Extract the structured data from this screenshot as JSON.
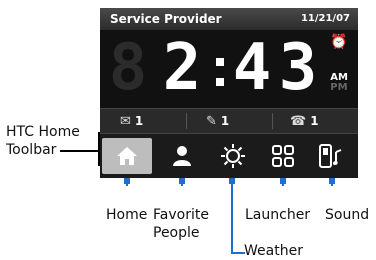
{
  "header": {
    "provider": "Service Provider",
    "date": "11/21/07"
  },
  "clock": {
    "digits": [
      "2",
      ":",
      "4",
      "3"
    ],
    "ampm": [
      "AM",
      "PM"
    ],
    "alarm_icon": "alarm-clock-icon"
  },
  "status": [
    {
      "icon": "email-icon",
      "value": "1"
    },
    {
      "icon": "message-icon",
      "value": "1"
    },
    {
      "icon": "missed-call-icon",
      "value": "1"
    }
  ],
  "toolbar": {
    "tabs": [
      {
        "name": "Home",
        "icon": "home-icon"
      },
      {
        "name": "Favorite People",
        "icon": "person-icon"
      },
      {
        "name": "Weather",
        "icon": "sun-icon"
      },
      {
        "name": "Launcher",
        "icon": "launcher-icon"
      },
      {
        "name": "Sound",
        "icon": "phone-sound-icon"
      }
    ]
  },
  "callouts": {
    "toolbar_line1": "HTC Home",
    "toolbar_line2": "Toolbar",
    "home": "Home",
    "favorite_line1": "Favorite",
    "favorite_line2": "People",
    "weather": "Weather",
    "launcher": "Launcher",
    "sound": "Sound"
  },
  "colors": {
    "accent_blue": "#1f6fd1",
    "screen_bg": "#1c1c1c"
  }
}
